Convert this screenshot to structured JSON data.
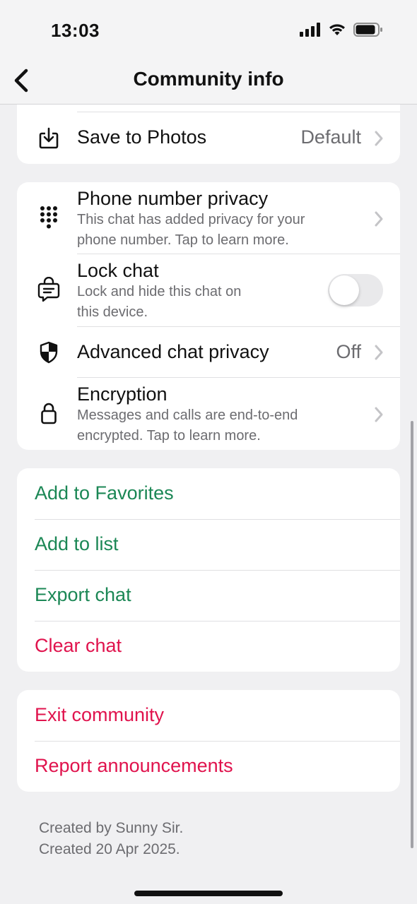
{
  "status_bar": {
    "time": "13:03"
  },
  "nav": {
    "title": "Community info"
  },
  "save_to_photos": {
    "title": "Save to Photos",
    "value": "Default"
  },
  "privacy": {
    "phone_number": {
      "title": "Phone number privacy",
      "subtitle_line1": "This chat has added privacy for your",
      "subtitle_line2": "phone number. Tap to learn more."
    },
    "lock_chat": {
      "title": "Lock chat",
      "subtitle_line1": "Lock and hide this chat on",
      "subtitle_line2": "this device.",
      "enabled": false
    },
    "advanced": {
      "title": "Advanced chat privacy",
      "value": "Off"
    },
    "encryption": {
      "title": "Encryption",
      "subtitle_line1": "Messages and calls are end-to-end",
      "subtitle_line2": "encrypted. Tap to learn more."
    }
  },
  "actions": [
    {
      "label": "Add to Favorites"
    },
    {
      "label": "Add to list"
    },
    {
      "label": "Export chat"
    },
    {
      "label": "Clear chat"
    }
  ],
  "danger_actions": [
    {
      "label": "Exit community"
    },
    {
      "label": "Report announcements"
    }
  ],
  "footer": {
    "created_by": "Created by Sunny Sir.",
    "created_date": "Created 20 Apr 2025."
  },
  "colors": {
    "accent_green": "#1b8755",
    "danger_red": "#e0134d",
    "secondary_text": "#6c6c70",
    "background": "#f0f0f2"
  }
}
